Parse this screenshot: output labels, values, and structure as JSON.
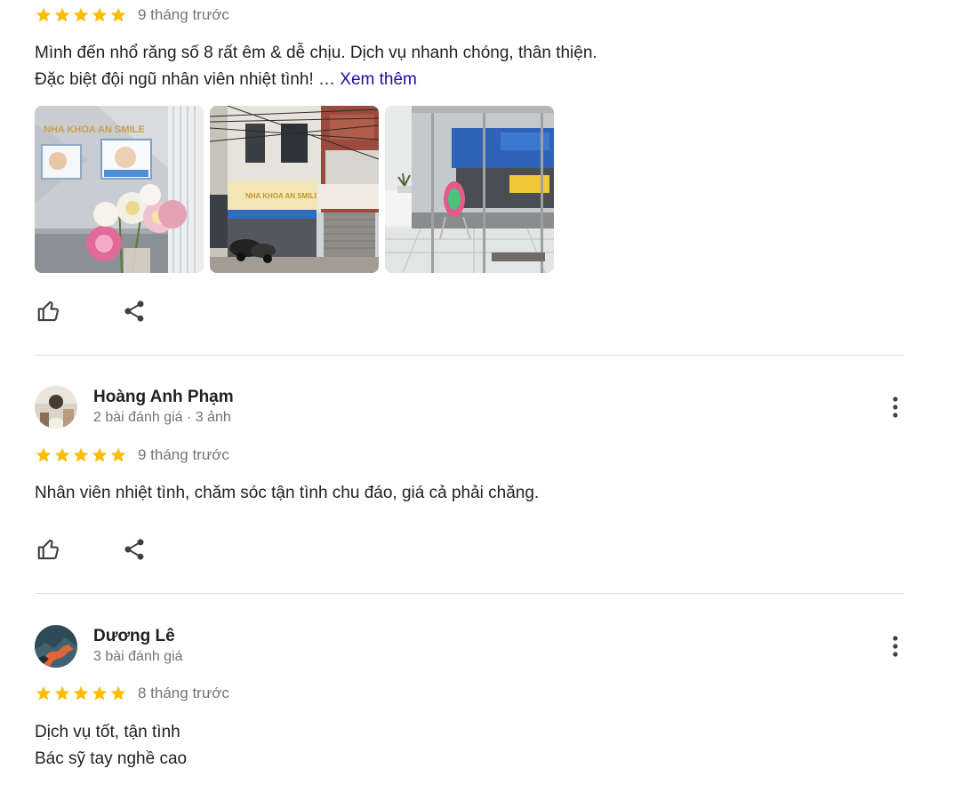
{
  "colors": {
    "star": "#fbbc04",
    "link": "#1a0dab",
    "text": "#202124",
    "meta": "#70757a",
    "divider": "#dadce0"
  },
  "reviews": [
    {
      "rating": 5,
      "time": "9 tháng trước",
      "text_lines": [
        "Mình đến nhổ răng số 8 rất êm & dễ chịu. Dịch vụ nhanh chóng, thân thiện.",
        "Đặc biệt đội ngũ nhân viên nhiệt tình! …"
      ],
      "more_label": "Xem thêm",
      "photos": [
        {
          "icon": "clinic-reception-photo",
          "sign_text": "NHA KHOA AN SMILE"
        },
        {
          "icon": "clinic-storefront-photo",
          "sign_text": "NHA KHOA AN SMILE"
        },
        {
          "icon": "clinic-entrance-photo"
        }
      ],
      "actions": {
        "like_icon": "thumbs-up-icon",
        "share_icon": "share-icon"
      }
    },
    {
      "name": "Hoàng Anh Phạm",
      "meta": "2 bài đánh giá · 3 ảnh",
      "rating": 5,
      "time": "9 tháng trước",
      "text_lines": [
        "Nhân viên nhiệt tình, chăm sóc tận tình chu đáo, giá cả phải chăng."
      ],
      "actions": {
        "like_icon": "thumbs-up-icon",
        "share_icon": "share-icon"
      },
      "more_icon": "more-vert-icon"
    },
    {
      "name": "Dương Lê",
      "meta": "3 bài đánh giá",
      "rating": 5,
      "time": "8 tháng trước",
      "text_lines": [
        "Dịch vụ tốt, tận tình",
        "Bác sỹ tay nghề cao"
      ],
      "more_icon": "more-vert-icon"
    }
  ]
}
